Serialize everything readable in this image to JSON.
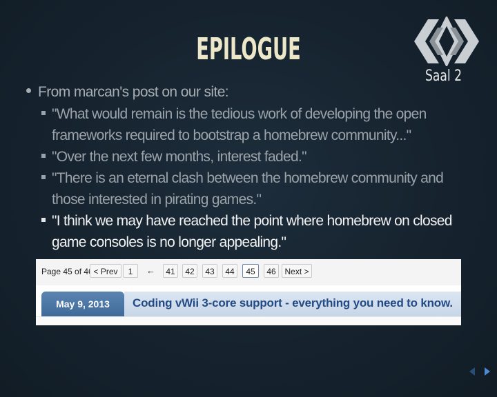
{
  "slide": {
    "title": "EPILOGUE",
    "room": "Saal 2",
    "bullet": "From marcan's post on our site:",
    "subbullets": [
      "\"What would remain is the tedious work of developing the open frameworks required to bootstrap a homebrew community...\"",
      "\"Over the next few months, interest faded.\"",
      "\"There is an eternal clash between the homebrew community and those interested in pirating games.\"",
      "\"I think we may have reached the point where homebrew on closed game consoles is no longer appealing.\""
    ]
  },
  "screenshot": {
    "page_label": "Page 45 of 46",
    "prev": "< Prev",
    "first": "1",
    "ellipsis_arrow": "←",
    "pages": [
      "41",
      "42",
      "43",
      "44",
      "45",
      "46"
    ],
    "current_page": "45",
    "next": "Next >",
    "post_date": "May 9, 2013",
    "post_title": "Coding vWii 3-core support - everything you need to know."
  },
  "nav_icons": [
    "previous-slide-icon",
    "next-slide-icon"
  ],
  "colors": {
    "background": "#16232f",
    "title": "#ece7c9",
    "link": "#234a84",
    "date_tab": "#4a76a5"
  }
}
